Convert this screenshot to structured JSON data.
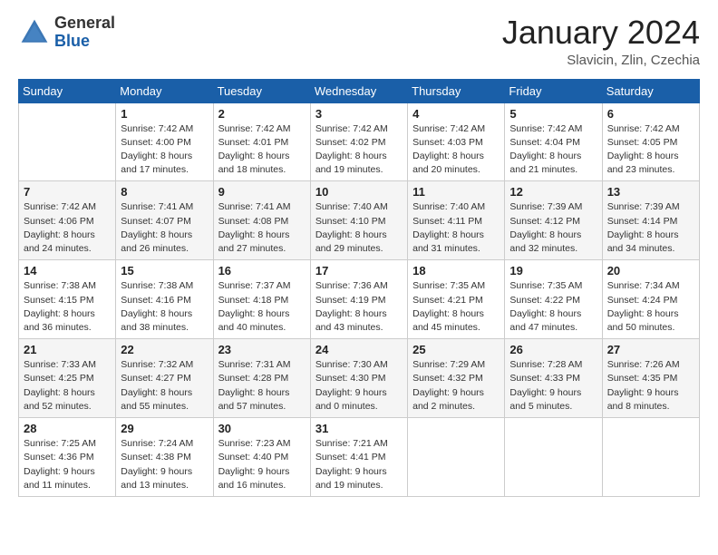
{
  "header": {
    "logo_general": "General",
    "logo_blue": "Blue",
    "title": "January 2024",
    "location": "Slavicin, Zlin, Czechia"
  },
  "weekdays": [
    "Sunday",
    "Monday",
    "Tuesday",
    "Wednesday",
    "Thursday",
    "Friday",
    "Saturday"
  ],
  "weeks": [
    [
      {
        "day": "",
        "info": ""
      },
      {
        "day": "1",
        "info": "Sunrise: 7:42 AM\nSunset: 4:00 PM\nDaylight: 8 hours\nand 17 minutes."
      },
      {
        "day": "2",
        "info": "Sunrise: 7:42 AM\nSunset: 4:01 PM\nDaylight: 8 hours\nand 18 minutes."
      },
      {
        "day": "3",
        "info": "Sunrise: 7:42 AM\nSunset: 4:02 PM\nDaylight: 8 hours\nand 19 minutes."
      },
      {
        "day": "4",
        "info": "Sunrise: 7:42 AM\nSunset: 4:03 PM\nDaylight: 8 hours\nand 20 minutes."
      },
      {
        "day": "5",
        "info": "Sunrise: 7:42 AM\nSunset: 4:04 PM\nDaylight: 8 hours\nand 21 minutes."
      },
      {
        "day": "6",
        "info": "Sunrise: 7:42 AM\nSunset: 4:05 PM\nDaylight: 8 hours\nand 23 minutes."
      }
    ],
    [
      {
        "day": "7",
        "info": "Sunrise: 7:42 AM\nSunset: 4:06 PM\nDaylight: 8 hours\nand 24 minutes."
      },
      {
        "day": "8",
        "info": "Sunrise: 7:41 AM\nSunset: 4:07 PM\nDaylight: 8 hours\nand 26 minutes."
      },
      {
        "day": "9",
        "info": "Sunrise: 7:41 AM\nSunset: 4:08 PM\nDaylight: 8 hours\nand 27 minutes."
      },
      {
        "day": "10",
        "info": "Sunrise: 7:40 AM\nSunset: 4:10 PM\nDaylight: 8 hours\nand 29 minutes."
      },
      {
        "day": "11",
        "info": "Sunrise: 7:40 AM\nSunset: 4:11 PM\nDaylight: 8 hours\nand 31 minutes."
      },
      {
        "day": "12",
        "info": "Sunrise: 7:39 AM\nSunset: 4:12 PM\nDaylight: 8 hours\nand 32 minutes."
      },
      {
        "day": "13",
        "info": "Sunrise: 7:39 AM\nSunset: 4:14 PM\nDaylight: 8 hours\nand 34 minutes."
      }
    ],
    [
      {
        "day": "14",
        "info": "Sunrise: 7:38 AM\nSunset: 4:15 PM\nDaylight: 8 hours\nand 36 minutes."
      },
      {
        "day": "15",
        "info": "Sunrise: 7:38 AM\nSunset: 4:16 PM\nDaylight: 8 hours\nand 38 minutes."
      },
      {
        "day": "16",
        "info": "Sunrise: 7:37 AM\nSunset: 4:18 PM\nDaylight: 8 hours\nand 40 minutes."
      },
      {
        "day": "17",
        "info": "Sunrise: 7:36 AM\nSunset: 4:19 PM\nDaylight: 8 hours\nand 43 minutes."
      },
      {
        "day": "18",
        "info": "Sunrise: 7:35 AM\nSunset: 4:21 PM\nDaylight: 8 hours\nand 45 minutes."
      },
      {
        "day": "19",
        "info": "Sunrise: 7:35 AM\nSunset: 4:22 PM\nDaylight: 8 hours\nand 47 minutes."
      },
      {
        "day": "20",
        "info": "Sunrise: 7:34 AM\nSunset: 4:24 PM\nDaylight: 8 hours\nand 50 minutes."
      }
    ],
    [
      {
        "day": "21",
        "info": "Sunrise: 7:33 AM\nSunset: 4:25 PM\nDaylight: 8 hours\nand 52 minutes."
      },
      {
        "day": "22",
        "info": "Sunrise: 7:32 AM\nSunset: 4:27 PM\nDaylight: 8 hours\nand 55 minutes."
      },
      {
        "day": "23",
        "info": "Sunrise: 7:31 AM\nSunset: 4:28 PM\nDaylight: 8 hours\nand 57 minutes."
      },
      {
        "day": "24",
        "info": "Sunrise: 7:30 AM\nSunset: 4:30 PM\nDaylight: 9 hours\nand 0 minutes."
      },
      {
        "day": "25",
        "info": "Sunrise: 7:29 AM\nSunset: 4:32 PM\nDaylight: 9 hours\nand 2 minutes."
      },
      {
        "day": "26",
        "info": "Sunrise: 7:28 AM\nSunset: 4:33 PM\nDaylight: 9 hours\nand 5 minutes."
      },
      {
        "day": "27",
        "info": "Sunrise: 7:26 AM\nSunset: 4:35 PM\nDaylight: 9 hours\nand 8 minutes."
      }
    ],
    [
      {
        "day": "28",
        "info": "Sunrise: 7:25 AM\nSunset: 4:36 PM\nDaylight: 9 hours\nand 11 minutes."
      },
      {
        "day": "29",
        "info": "Sunrise: 7:24 AM\nSunset: 4:38 PM\nDaylight: 9 hours\nand 13 minutes."
      },
      {
        "day": "30",
        "info": "Sunrise: 7:23 AM\nSunset: 4:40 PM\nDaylight: 9 hours\nand 16 minutes."
      },
      {
        "day": "31",
        "info": "Sunrise: 7:21 AM\nSunset: 4:41 PM\nDaylight: 9 hours\nand 19 minutes."
      },
      {
        "day": "",
        "info": ""
      },
      {
        "day": "",
        "info": ""
      },
      {
        "day": "",
        "info": ""
      }
    ]
  ]
}
